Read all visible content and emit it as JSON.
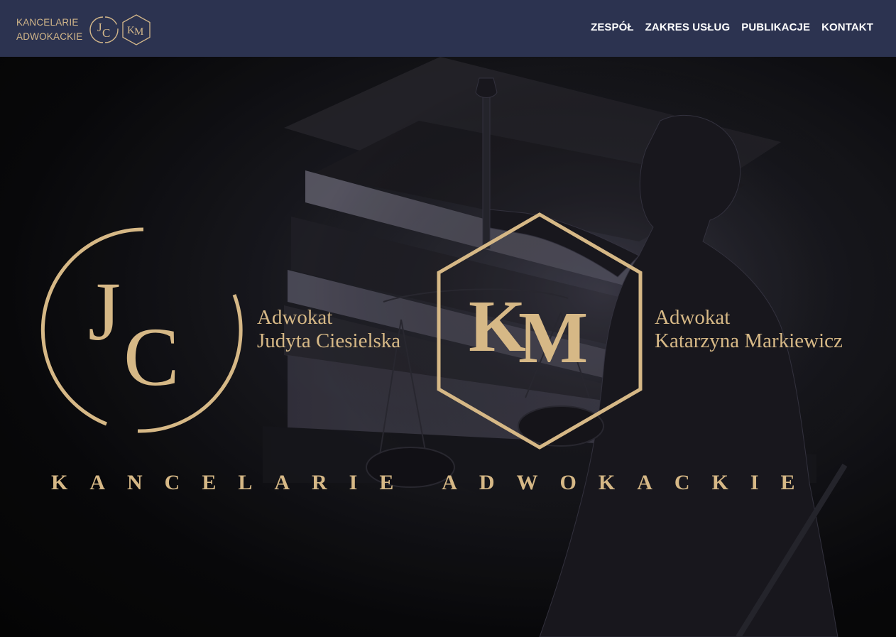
{
  "header": {
    "brand_line1": "KANCELARIE",
    "brand_line2": "ADWOKACKIE",
    "brand_mark_jc": "JC",
    "brand_mark_km": "KM",
    "nav": [
      {
        "label": "ZESPÓŁ"
      },
      {
        "label": "ZAKRES USŁUG"
      },
      {
        "label": "PUBLIKACJE"
      },
      {
        "label": "KONTAKT"
      }
    ]
  },
  "hero": {
    "jc": {
      "monogram_j": "J",
      "monogram_c": "C",
      "title": "Adwokat",
      "name": "Judyta Ciesielska"
    },
    "km": {
      "monogram_k": "K",
      "monogram_m": "M",
      "title": "Adwokat",
      "name": "Katarzyna Markiewicz"
    },
    "tagline": "KANCELARIE ADWOKACKIE"
  },
  "colors": {
    "header_bg": "#2c3350",
    "gold": "#d6b886",
    "nav_text": "#ffffff",
    "hero_bg": "#050505"
  }
}
